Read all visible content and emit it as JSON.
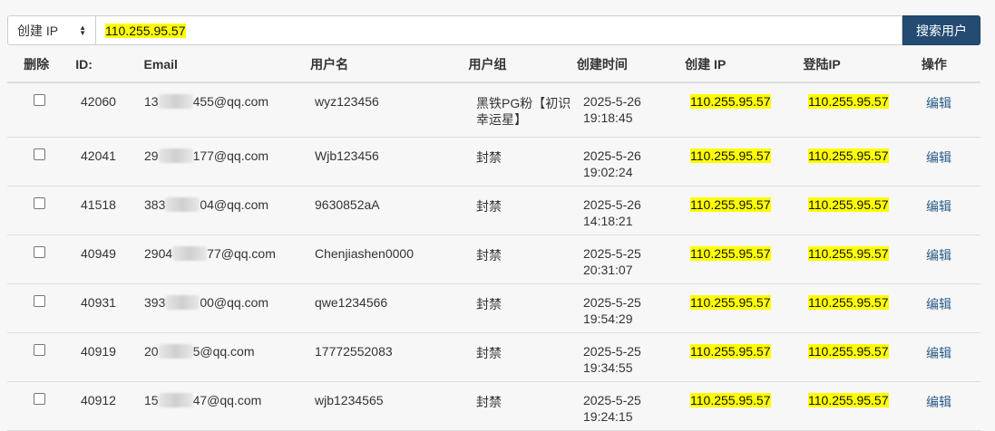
{
  "search": {
    "select_value": "创建 IP",
    "query": "110.255.95.57",
    "button_label": "搜索用户"
  },
  "table": {
    "headers": {
      "delete": "删除",
      "id": "ID:",
      "email": "Email",
      "username": "用户名",
      "group": "用户组",
      "created_time": "创建时间",
      "created_ip": "创建 IP",
      "login_ip": "登陆IP",
      "action": "操作"
    },
    "rows": [
      {
        "id": "42060",
        "email_prefix": "13",
        "email_suffix": "455@qq.com",
        "username": "wyz123456",
        "group": "黑铁PG粉【初识幸运星】",
        "date": "2025-5-26",
        "time": "19:18:45",
        "created_ip": "110.255.95.57",
        "login_ip": "110.255.95.57",
        "action": "编辑"
      },
      {
        "id": "42041",
        "email_prefix": "29",
        "email_suffix": "177@qq.com",
        "username": "Wjb123456",
        "group": "封禁",
        "date": "2025-5-26",
        "time": "19:02:24",
        "created_ip": "110.255.95.57",
        "login_ip": "110.255.95.57",
        "action": "编辑"
      },
      {
        "id": "41518",
        "email_prefix": "383",
        "email_suffix": "04@qq.com",
        "username": "9630852aA",
        "group": "封禁",
        "date": "2025-5-26",
        "time": "14:18:21",
        "created_ip": "110.255.95.57",
        "login_ip": "110.255.95.57",
        "action": "编辑"
      },
      {
        "id": "40949",
        "email_prefix": "2904",
        "email_suffix": "77@qq.com",
        "username": "Chenjiashen0000",
        "group": "封禁",
        "date": "2025-5-25",
        "time": "20:31:07",
        "created_ip": "110.255.95.57",
        "login_ip": "110.255.95.57",
        "action": "编辑"
      },
      {
        "id": "40931",
        "email_prefix": "393",
        "email_suffix": "00@qq.com",
        "username": "qwe1234566",
        "group": "封禁",
        "date": "2025-5-25",
        "time": "19:54:29",
        "created_ip": "110.255.95.57",
        "login_ip": "110.255.95.57",
        "action": "编辑"
      },
      {
        "id": "40919",
        "email_prefix": "20",
        "email_suffix": "5@qq.com",
        "username": "17772552083",
        "group": "封禁",
        "date": "2025-5-25",
        "time": "19:34:55",
        "created_ip": "110.255.95.57",
        "login_ip": "110.255.95.57",
        "action": "编辑"
      },
      {
        "id": "40912",
        "email_prefix": "15",
        "email_suffix": "47@qq.com",
        "username": "wjb1234565",
        "group": "封禁",
        "date": "2025-5-25",
        "time": "19:24:15",
        "created_ip": "110.255.95.57",
        "login_ip": "110.255.95.57",
        "action": "编辑"
      }
    ]
  },
  "colors": {
    "button_bg": "#244c72",
    "highlight": "#ffff00",
    "link": "#2a5c8a"
  }
}
